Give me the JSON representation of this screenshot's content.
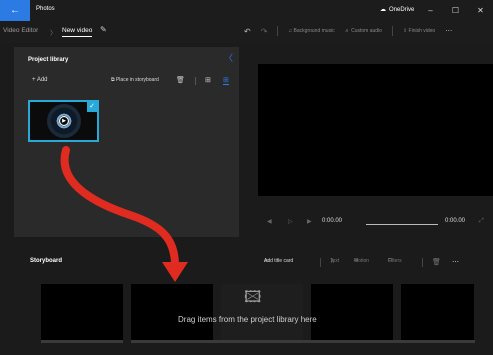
{
  "app": {
    "name": "Photos",
    "back_glyph": "←",
    "onedrive_label": "OneDrive",
    "minimize": "–",
    "maximize": "☐",
    "close": "✕"
  },
  "toolbar": {
    "breadcrumb_parent": "Video Editor",
    "breadcrumb_sep": "〉",
    "breadcrumb_current": "New video",
    "edit_glyph": "✎",
    "undo_glyph": "↶",
    "redo_glyph": "↷",
    "background_music": "Background music",
    "custom_audio": "Custom audio",
    "finish_video": "Finish video",
    "more": "⋯"
  },
  "library": {
    "title": "Project library",
    "collapse_glyph": "〈",
    "add_label": "+ Add",
    "place_label": "Place in storyboard",
    "trash_glyph": "🗑",
    "grid_a_glyph": "⊞",
    "grid_b_glyph": "⊞",
    "check_glyph": "✓",
    "play_glyph": "▶"
  },
  "playback": {
    "rewind": "◀",
    "play": "▷",
    "forward": "▶",
    "current_time": "0:00.00",
    "end_time": "0:00.00",
    "expand": "⤢"
  },
  "storyboard": {
    "title": "Storyboard",
    "add_title_card": "Add title card",
    "text": "Text",
    "motion": "Motion",
    "filters": "Filters",
    "trash_glyph": "🗑",
    "more": "⋯",
    "drag_hint": "Drag items from the project library here",
    "media_glyph": "🖾"
  },
  "colors": {
    "accent": "#2c7be5",
    "selection": "#29a9d8",
    "arrow": "#e02b20"
  }
}
